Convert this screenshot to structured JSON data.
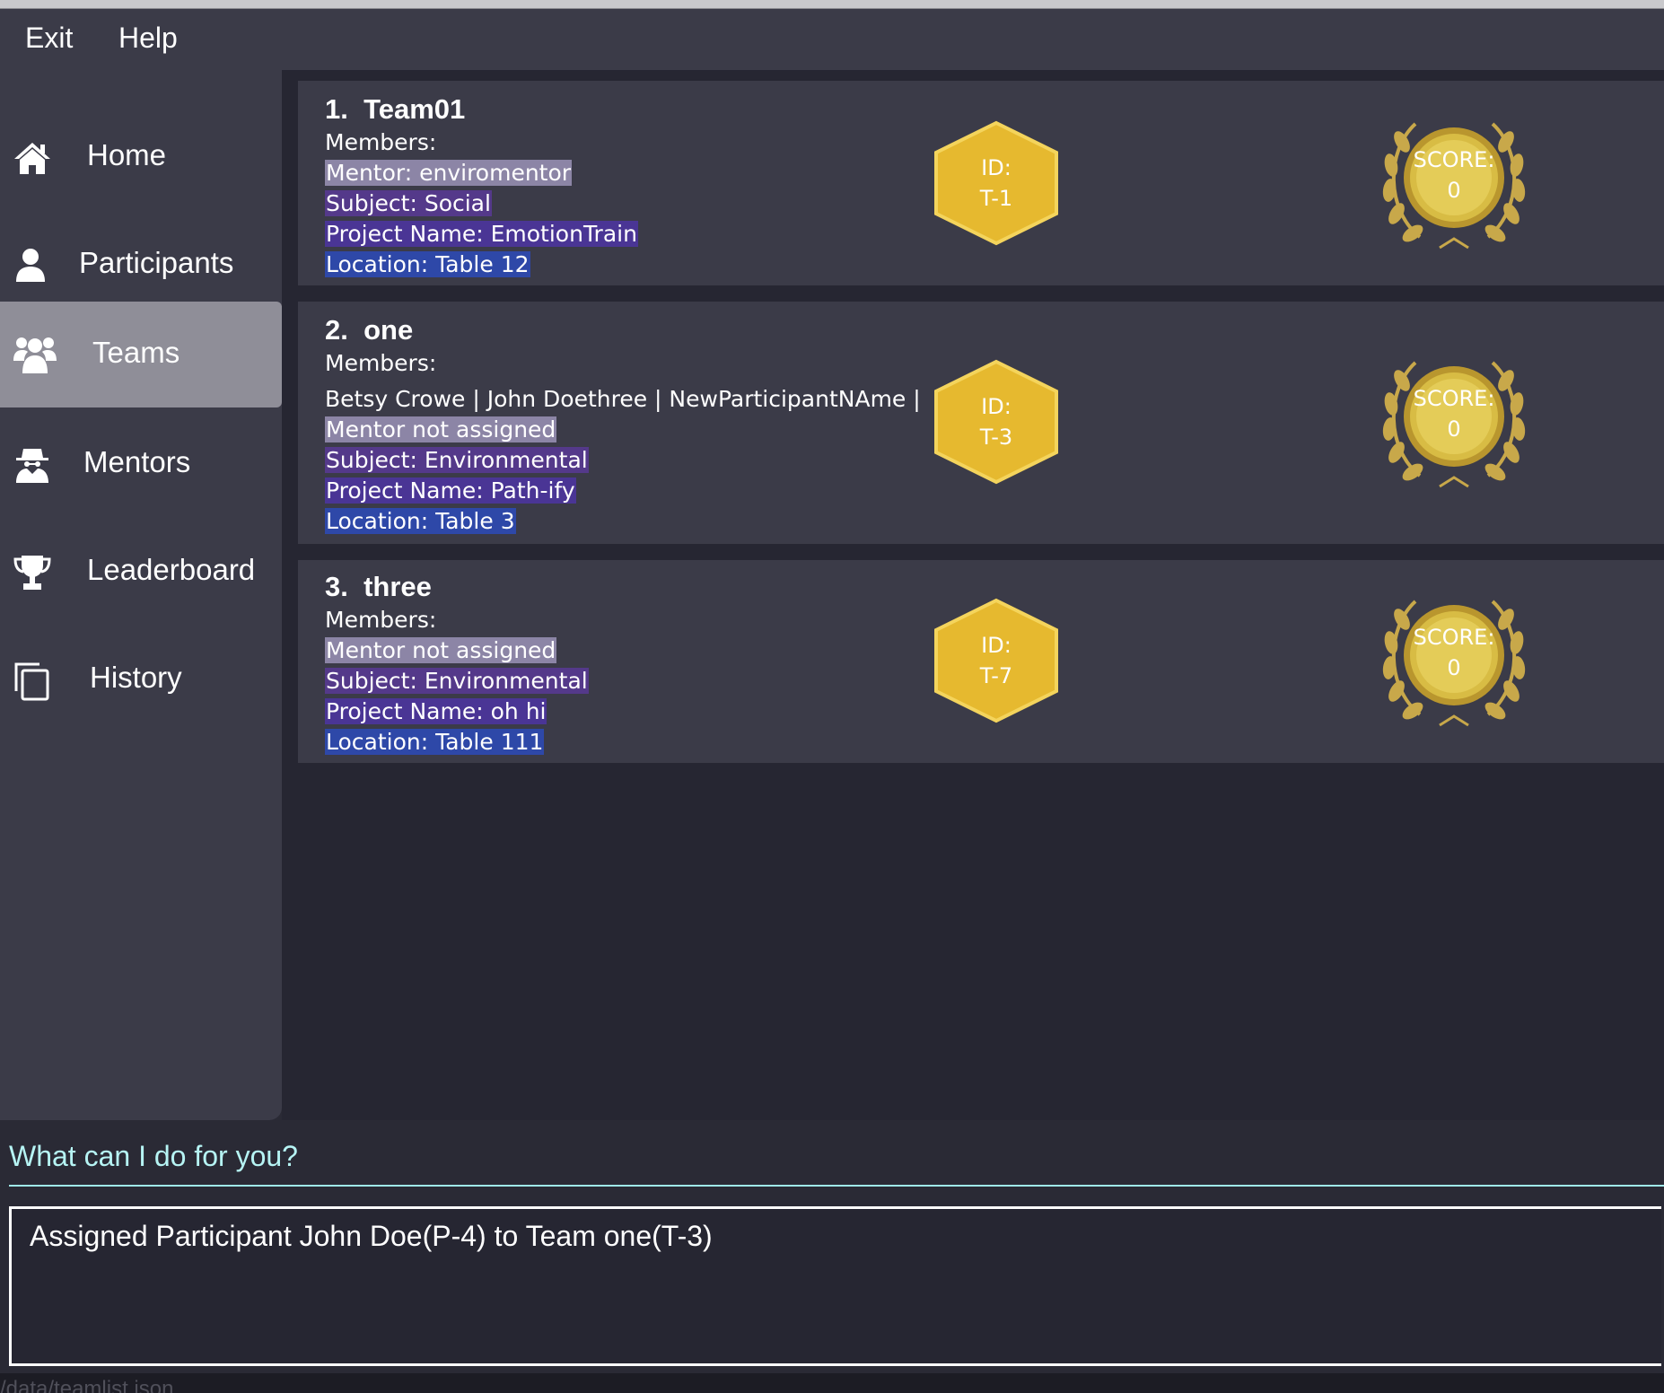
{
  "menubar": {
    "exit_label": "Exit",
    "help_label": "Help"
  },
  "sidebar": {
    "items": [
      {
        "label": "Home",
        "icon": "home-icon",
        "active": false
      },
      {
        "label": "Participants",
        "icon": "person-icon",
        "active": false
      },
      {
        "label": "Teams",
        "icon": "group-icon",
        "active": true
      },
      {
        "label": "Mentors",
        "icon": "spy-icon",
        "active": false
      },
      {
        "label": "Leaderboard",
        "icon": "trophy-icon",
        "active": false
      },
      {
        "label": "History",
        "icon": "copy-icon",
        "active": false
      }
    ]
  },
  "teams": [
    {
      "index": "1.",
      "name": "Team01",
      "members_label": "Members:",
      "mentor": "Mentor: enviromentor",
      "subject": "Subject: Social",
      "project": "Project Name: EmotionTrain",
      "location": "Location:  Table 12",
      "id_label": "ID:",
      "id": "T-1",
      "score_label": "SCORE:",
      "score": "0"
    },
    {
      "index": "2.",
      "name": "one",
      "members_label": "Members:",
      "members_list": "Betsy Crowe | John Doethree | NewParticipantNAme |",
      "mentor": "Mentor not assigned",
      "subject": "Subject: Environmental",
      "project": "Project Name: Path-ify",
      "location": "Location:  Table 3",
      "id_label": "ID:",
      "id": "T-3",
      "score_label": "SCORE:",
      "score": "0"
    },
    {
      "index": "3.",
      "name": "three",
      "members_label": "Members:",
      "mentor": "Mentor not assigned",
      "subject": "Subject: Environmental",
      "project": "Project Name: oh hi",
      "location": "Location:  Table 111",
      "id_label": "ID:",
      "id": "T-7",
      "score_label": "SCORE:",
      "score": "0"
    }
  ],
  "command": {
    "placeholder": "What can I do for you?",
    "result": "Assigned Participant John Doe(P-4) to Team one(T-3)"
  },
  "status": {
    "file_path": "/data/teamlist.json"
  },
  "colors": {
    "background": "#2a2a35",
    "panel": "#3b3b48",
    "active_nav": "#8f8e98",
    "badge_gold": "#e6b92f",
    "command_text": "#b6f4f4"
  }
}
